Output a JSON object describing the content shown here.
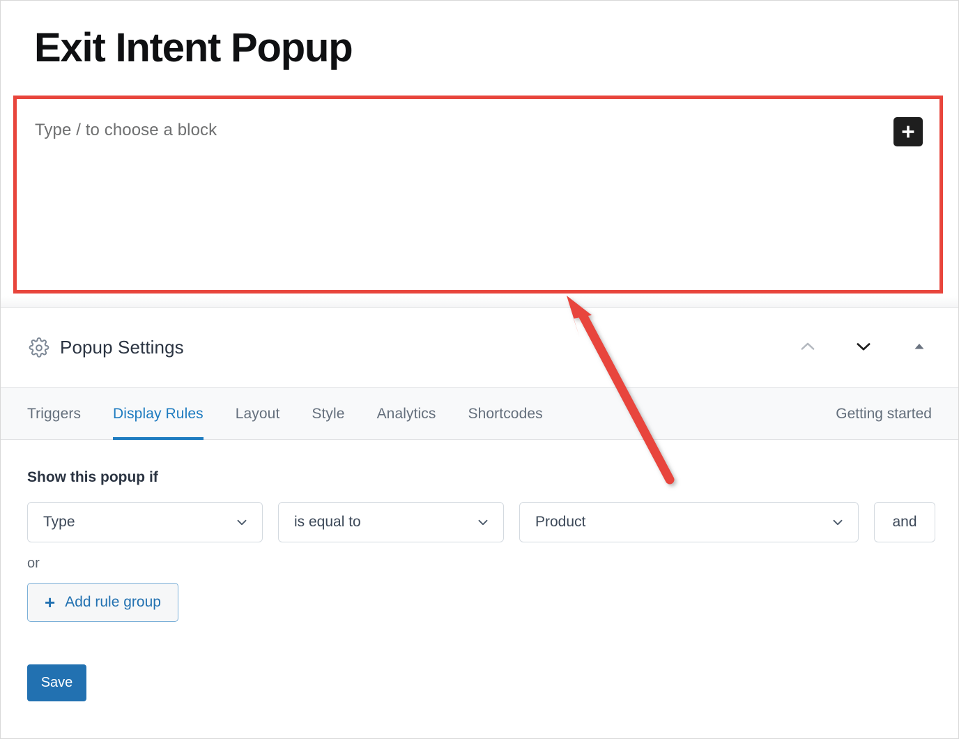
{
  "editor": {
    "title": "Exit Intent Popup",
    "block_placeholder": "Type / to choose a block",
    "inserter_icon": "plus-icon"
  },
  "panel": {
    "icon": "gear-icon",
    "title": "Popup Settings",
    "header_actions": [
      {
        "icon": "chevron-up-icon",
        "name": "move-up-button"
      },
      {
        "icon": "chevron-down-icon",
        "name": "move-down-button"
      },
      {
        "icon": "triangle-up-icon",
        "name": "collapse-panel-button"
      }
    ]
  },
  "tabs": {
    "items": [
      {
        "label": "Triggers",
        "active": false
      },
      {
        "label": "Display Rules",
        "active": true
      },
      {
        "label": "Layout",
        "active": false
      },
      {
        "label": "Style",
        "active": false
      },
      {
        "label": "Analytics",
        "active": false
      },
      {
        "label": "Shortcodes",
        "active": false
      }
    ],
    "getting_started": "Getting started",
    "active_color": "#1f7cc0"
  },
  "display_rules": {
    "heading": "Show this popup if",
    "rule": {
      "field": "Type",
      "operator": "is equal to",
      "value": "Product",
      "conjunction_button": "and"
    },
    "or_label": "or",
    "add_rule_group": {
      "label": "Add rule group",
      "icon": "plus-icon"
    },
    "save_label": "Save"
  },
  "annotation": {
    "type": "arrow",
    "color": "#e8453c",
    "highlight_box_color": "#e8453c"
  }
}
